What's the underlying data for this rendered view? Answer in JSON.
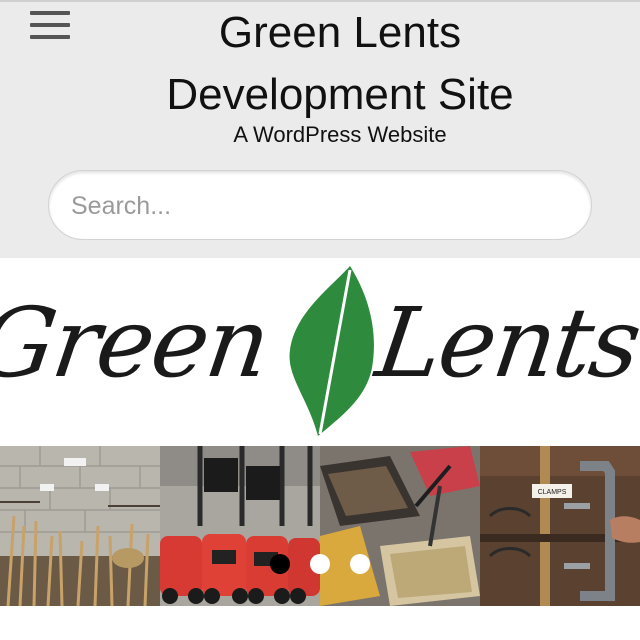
{
  "site": {
    "title": "Green Lents Development Site",
    "tagline": "A WordPress Website"
  },
  "search": {
    "placeholder": "Search...",
    "value": ""
  },
  "logo": {
    "word_left": "Green",
    "word_right": "Lents",
    "leaf_color": "#2e8b3e",
    "text_color": "#1a1a1a"
  },
  "slider": {
    "tiles": [
      {
        "subject": "rakes and garden tools against block wall"
      },
      {
        "subject": "red lawn mowers"
      },
      {
        "subject": "wheelbarrows"
      },
      {
        "subject": "clamps on shelf"
      }
    ],
    "clamps_label": "CLAMPS",
    "dots": [
      {
        "active": true
      },
      {
        "active": false
      },
      {
        "active": false
      }
    ]
  },
  "colors": {
    "header_bg": "#ebebeb",
    "active_dot": "#000000",
    "inactive_dot": "#ffffff"
  },
  "icons": [
    "hamburger-menu-icon",
    "leaf-icon"
  ]
}
